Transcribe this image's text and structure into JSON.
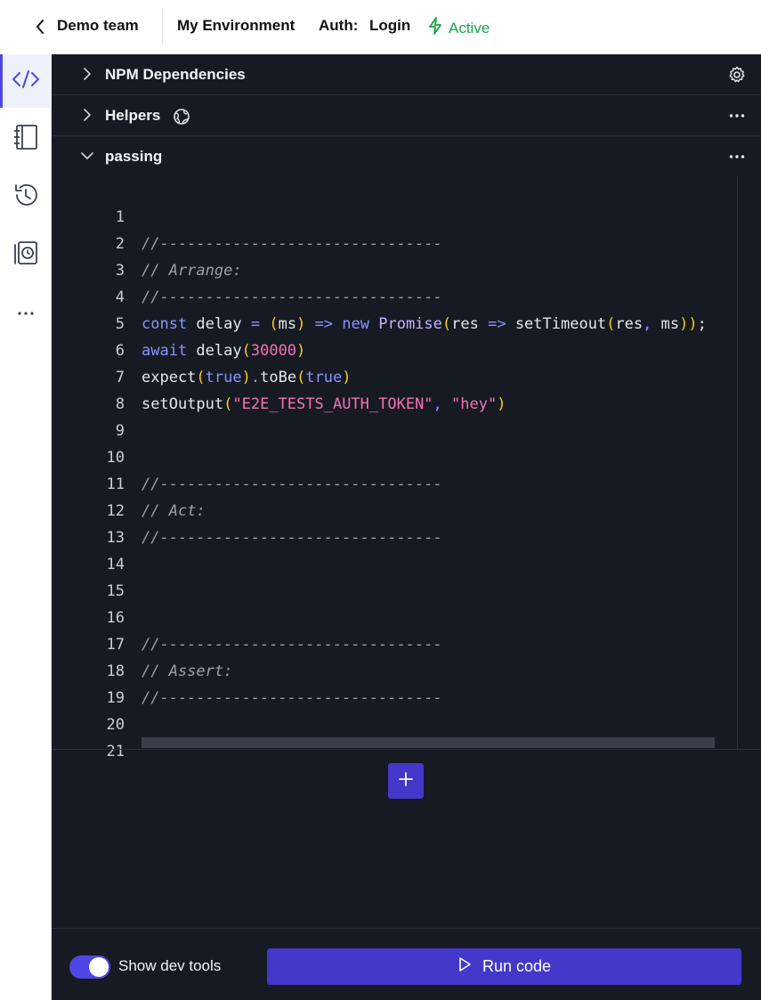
{
  "header": {
    "team_name": "Demo team",
    "environment": "My Environment",
    "auth_label": "Auth:",
    "auth_value": "Login",
    "status": "Active"
  },
  "rail": {
    "items": [
      "code-icon",
      "notebook-icon",
      "history-icon",
      "recording-icon",
      "more-icon"
    ]
  },
  "sections": [
    {
      "title": "NPM Dependencies",
      "action_icon": "gear-icon"
    },
    {
      "title": "Helpers",
      "title_icon": "globe-icon",
      "action_icon": "more-icon"
    },
    {
      "title": "passing",
      "action_icon": "more-icon"
    }
  ],
  "code": {
    "line_numbers": [
      "1",
      "2",
      "3",
      "4",
      "5",
      "6",
      "7",
      "8",
      "9",
      "10",
      "11",
      "12",
      "13",
      "14",
      "15",
      "16",
      "17",
      "18",
      "19",
      "20",
      "21"
    ],
    "comment_rule": "//-------------------------------",
    "arrange": "// Arrange:",
    "act": "// Act:",
    "assert": "// Assert:",
    "l4": {
      "const": "const",
      "delay": " delay ",
      "eq": "=",
      "sp": " ",
      "p1": "(",
      "ms": "ms",
      "p2": ")",
      "arrow": " => ",
      "new": "new",
      "promise": " Promise",
      "p3": "(",
      "res": "res",
      "arrow2": " => ",
      "settimeout": "setTimeout",
      "p4": "(",
      "res2": "res",
      "comma": ", ",
      "ms2": "ms",
      "p5": "))",
      "semi": ";"
    },
    "l5": {
      "await": "await",
      "delay": " delay",
      "p1": "(",
      "num": "30000",
      "p2": ")"
    },
    "l6": {
      "expect": "expect",
      "p1": "(",
      "true1": "true",
      "p2": ")",
      "dot": ".",
      "tobe": "toBe",
      "p3": "(",
      "true2": "true",
      "p4": ")"
    },
    "l7": {
      "fn": "setOutput",
      "p1": "(",
      "s1": "\"E2E_TESTS_AUTH_TOKEN\"",
      "comma": ", ",
      "s2": "\"hey\"",
      "p2": ")"
    }
  },
  "footer": {
    "toggle_label": "Show dev tools",
    "toggle_on": true,
    "run_label": "Run code"
  },
  "colors": {
    "accent": "#4338ca",
    "status_green": "#16a34a",
    "panel_bg": "#161a23"
  }
}
